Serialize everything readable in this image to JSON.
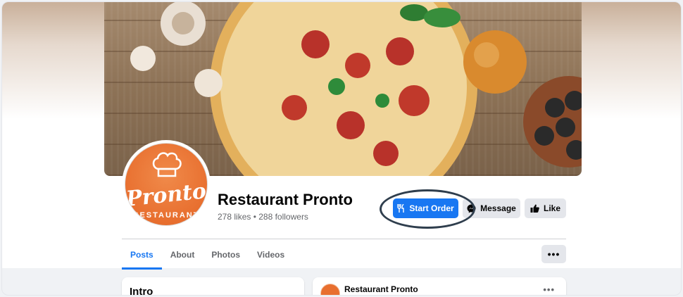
{
  "profile": {
    "name": "Restaurant Pronto",
    "stats": "278 likes • 288 followers",
    "avatar_brand": "Pronto",
    "avatar_sub": "RESTAURANT"
  },
  "actions": {
    "start_order": "Start Order",
    "message": "Message",
    "like": "Like",
    "more": "•••"
  },
  "tabs": [
    {
      "label": "Posts",
      "active": true
    },
    {
      "label": "About"
    },
    {
      "label": "Photos"
    },
    {
      "label": "Videos"
    }
  ],
  "intro": {
    "title": "Intro"
  },
  "post": {
    "author": "Restaurant Pronto",
    "more": "•••"
  },
  "icons": {
    "start_order": "fork-knife-icon",
    "message": "messenger-icon",
    "like": "thumbs-up-icon",
    "more": "more-dots-icon"
  },
  "colors": {
    "accent": "#1877f2",
    "brand": "#e86f2f",
    "annotation": "#2f3e4d"
  }
}
